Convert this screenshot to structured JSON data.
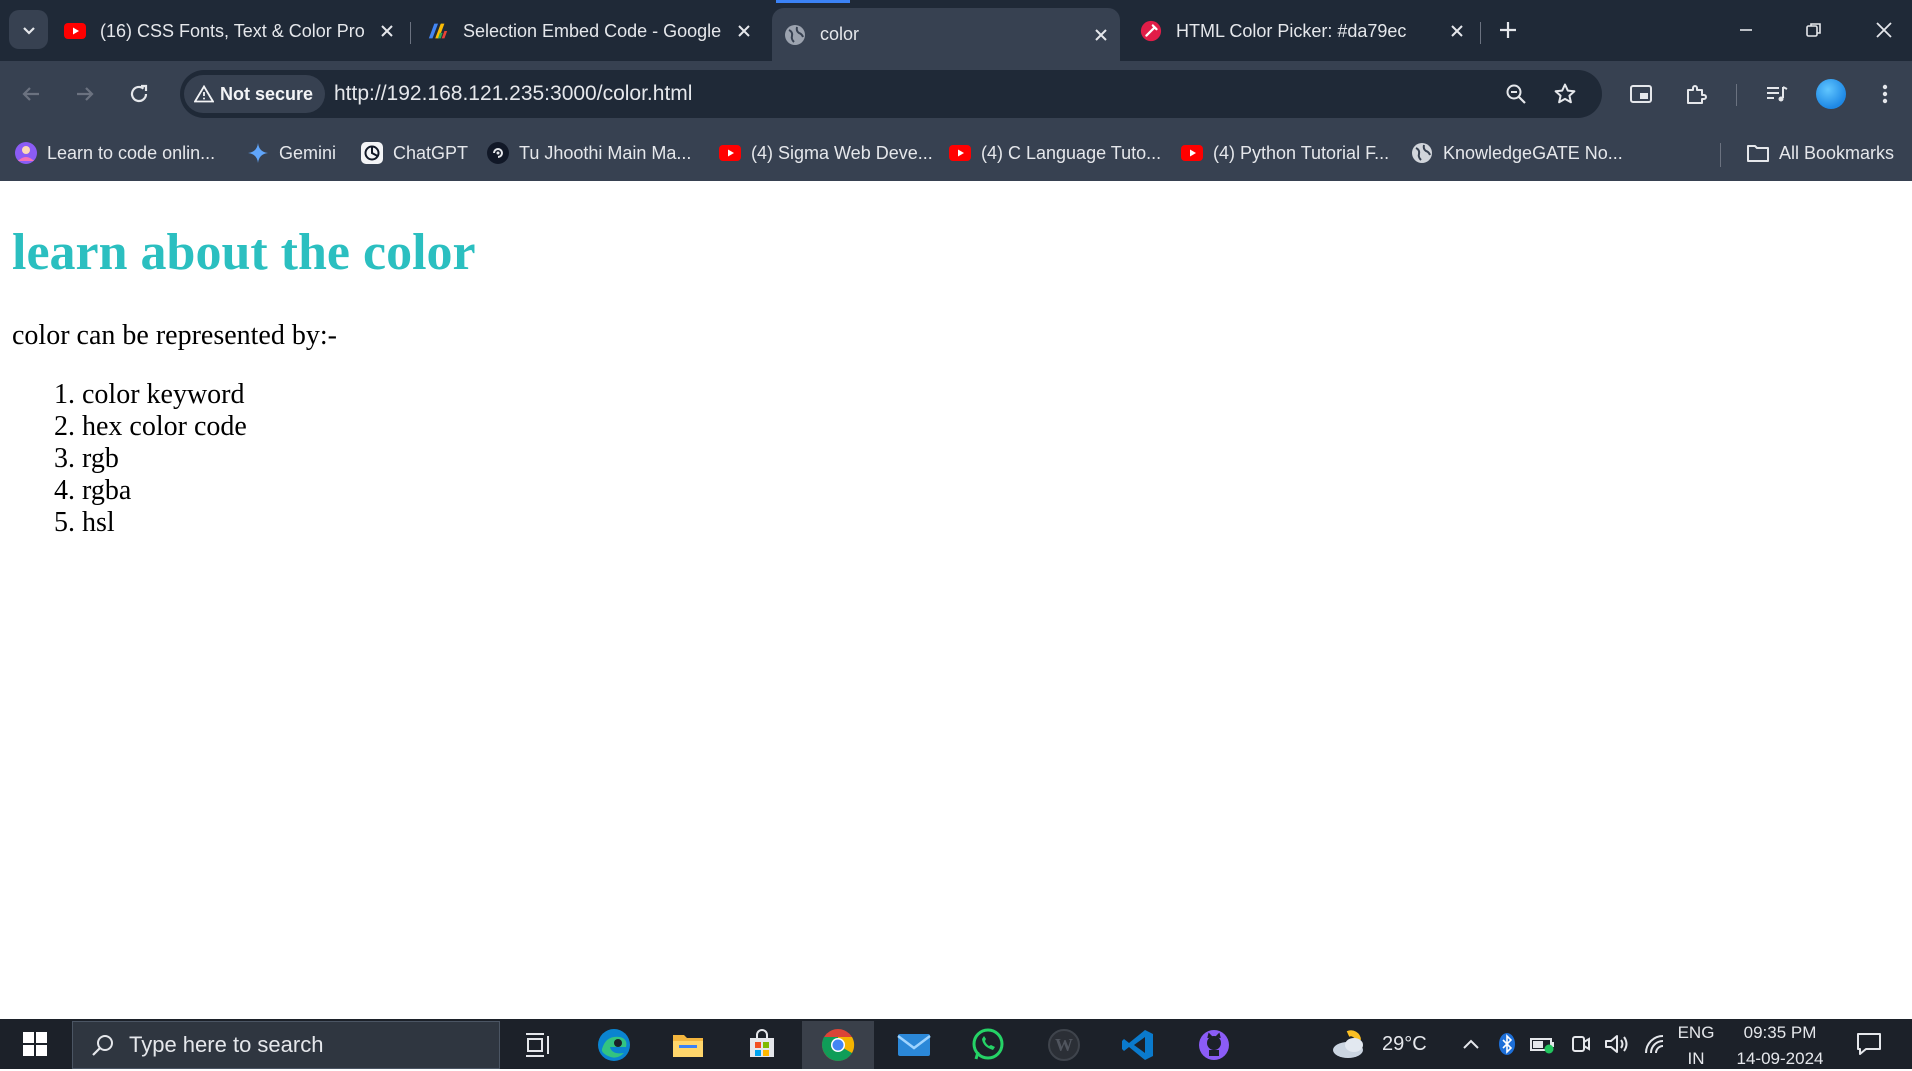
{
  "browser": {
    "tabs": [
      {
        "title": "(16) CSS Fonts, Text & Color Pro",
        "icon": "youtube-icon",
        "active": false
      },
      {
        "title": "Selection Embed Code - Google",
        "icon": "google-blocks-icon",
        "active": false
      },
      {
        "title": "color",
        "icon": "globe-icon",
        "active": true
      },
      {
        "title": "HTML Color Picker: #da79ec",
        "icon": "color-picker-icon",
        "active": false
      }
    ],
    "new_tab_label": "+",
    "address_bar": {
      "security_label": "Not secure",
      "url": "http://192.168.121.235:3000/color.html"
    },
    "bookmarks": [
      {
        "label": "Learn to code onlin...",
        "icon": "avatar-icon"
      },
      {
        "label": "Gemini",
        "icon": "gemini-sparkle-icon"
      },
      {
        "label": "ChatGPT",
        "icon": "chatgpt-icon"
      },
      {
        "label": "Tu Jhoothi Main Ma...",
        "icon": "disc-icon"
      },
      {
        "label": "(4) Sigma Web Deve...",
        "icon": "youtube-icon"
      },
      {
        "label": "(4) C Language Tuto...",
        "icon": "youtube-icon"
      },
      {
        "label": "(4) Python Tutorial F...",
        "icon": "youtube-icon"
      },
      {
        "label": "KnowledgeGATE No...",
        "icon": "globe-icon"
      }
    ],
    "all_bookmarks_label": "All Bookmarks"
  },
  "page": {
    "heading": "learn about the color",
    "intro": "color can be represented by:-",
    "list": [
      "color keyword",
      "hex color code",
      "rgb",
      "rgba",
      "hsl"
    ],
    "heading_color": "#2bbfc0"
  },
  "taskbar": {
    "search_placeholder": "Type here to search",
    "weather_temp": "29°C",
    "language": "ENG",
    "region": "IN",
    "time": "09:35 PM",
    "date": "14-09-2024"
  }
}
